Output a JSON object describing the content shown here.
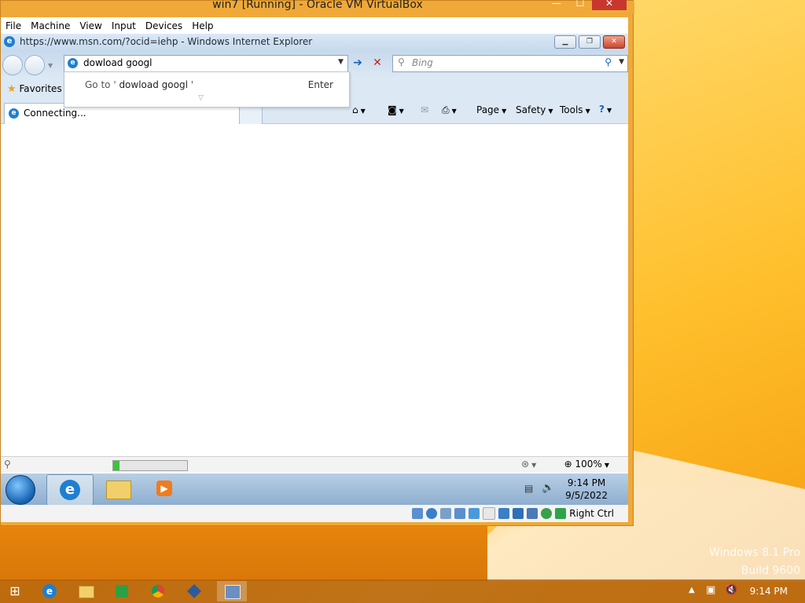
{
  "host": {
    "window_title": "win7 [Running] - Oracle VM VirtualBox",
    "menu": [
      "File",
      "Machine",
      "View",
      "Input",
      "Devices",
      "Help"
    ],
    "status_key": "Right Ctrl",
    "watermark_line1": "Windows 8.1 Pro",
    "watermark_line2": "Build 9600",
    "clock": "9:14 PM",
    "taskbar_icons": [
      "windows-logo-icon",
      "internet-explorer-icon",
      "file-explorer-icon",
      "store-icon",
      "chrome-icon",
      "virtualbox-icon",
      "virtualbox-vm-icon"
    ]
  },
  "ie": {
    "window_title": "https://www.msn.com/?ocid=iehp - Windows Internet Explorer",
    "address_value": "dowload googl",
    "search_placeholder": "Bing",
    "favorites_label": "Favorites",
    "tab_label": "Connecting...",
    "suggestion_prefix": "Go to '",
    "suggestion_value": " dowload googl ",
    "suggestion_suffix": "'",
    "suggestion_hint": "Enter",
    "commands": [
      "Page",
      "Safety",
      "Tools"
    ],
    "zoom": "100%",
    "progress": 0.08
  },
  "guest_taskbar": {
    "time": "9:14 PM",
    "date": "9/5/2022"
  },
  "colors": {
    "accent": "#1e7fd1",
    "host_close": "#c8372d",
    "progress": "#3cc43c"
  }
}
